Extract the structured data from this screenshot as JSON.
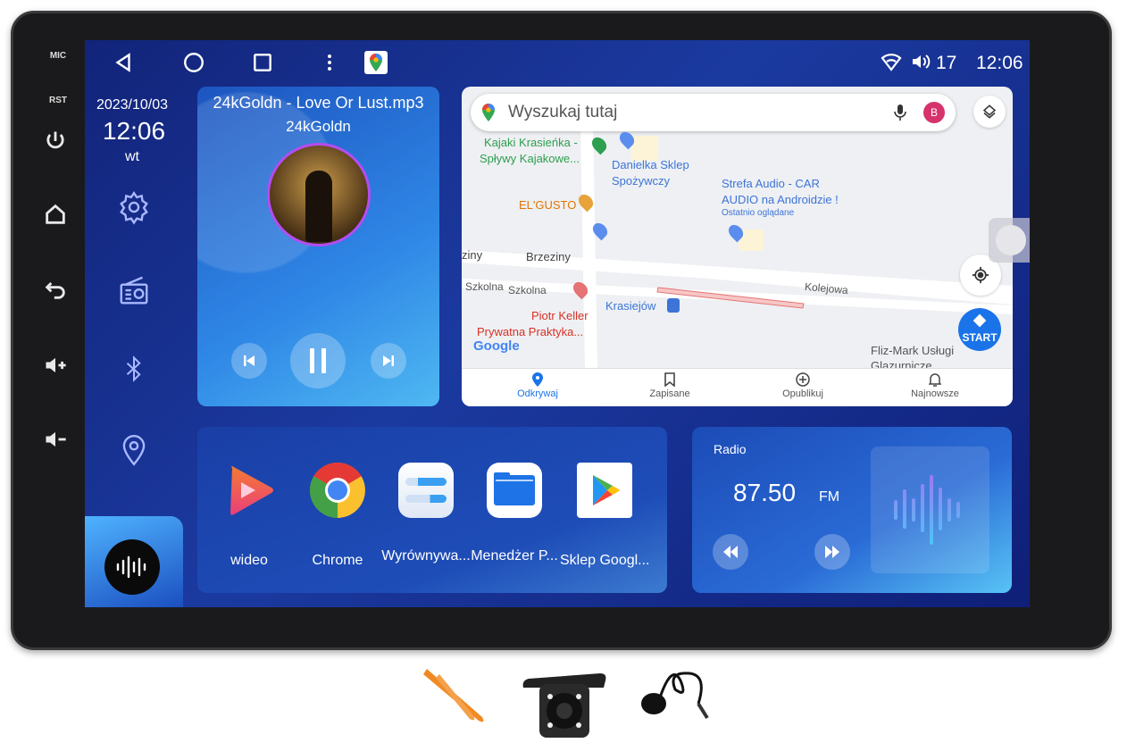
{
  "bezel": {
    "buttons": [
      "MIC",
      "RST"
    ],
    "icons": [
      "power-icon",
      "home-icon",
      "back-icon",
      "volume-up-icon",
      "volume-down-icon"
    ]
  },
  "status_bar": {
    "volume": "17",
    "time": "12:06"
  },
  "clock": {
    "date": "2023/10/03",
    "time": "12:06",
    "day": "wt"
  },
  "music": {
    "title": "24kGoldn - Love Or Lust.mp3",
    "artist": "24kGoldn"
  },
  "map": {
    "search_placeholder": "Wyszukaj tutaj",
    "avatar": "B",
    "labels": {
      "kajaki": "Kajaki Krasieńka -",
      "kajaki2": "Spływy Kajakowe...",
      "danielka": "Danielka Sklep",
      "danielka2": "Spożywczy",
      "strefa": "Strefa Audio - CAR",
      "strefa2": "AUDIO na Androidzie !",
      "strefa3": "Ostatnio oglądane",
      "elgusto": "EL'GUSTO",
      "brzeziny0": "ziny",
      "brzeziny": "Brzeziny",
      "szkolna1": "Szkolna",
      "szkolna2": "Szkolna",
      "kolejowa": "Kolejowa",
      "krasiejow": "Krasiejów",
      "piotr": "Piotr Keller",
      "piotr2": "Prywatna Praktyka...",
      "flizmark": "Fliz-Mark Usługi",
      "flizmark2": "Glazurnicze",
      "google": "Google",
      "start": "START"
    },
    "tabs": [
      {
        "label": "Odkrywaj",
        "active": true
      },
      {
        "label": "Zapisane"
      },
      {
        "label": "Opublikuj"
      },
      {
        "label": "Najnowsze"
      }
    ]
  },
  "apps": [
    {
      "label": "wideo"
    },
    {
      "label": "Chrome"
    },
    {
      "label": "Wyrównywa..."
    },
    {
      "label": "Menedżer P..."
    },
    {
      "label": "Sklep Googl..."
    }
  ],
  "radio": {
    "title": "Radio",
    "frequency": "87.50",
    "band": "FM"
  },
  "colors": {
    "accent": "#1a73e8",
    "screen_bg": "#1b3aa0",
    "map_green": "#2e9e4f",
    "map_orange": "#e37400",
    "map_red": "#d93025"
  }
}
